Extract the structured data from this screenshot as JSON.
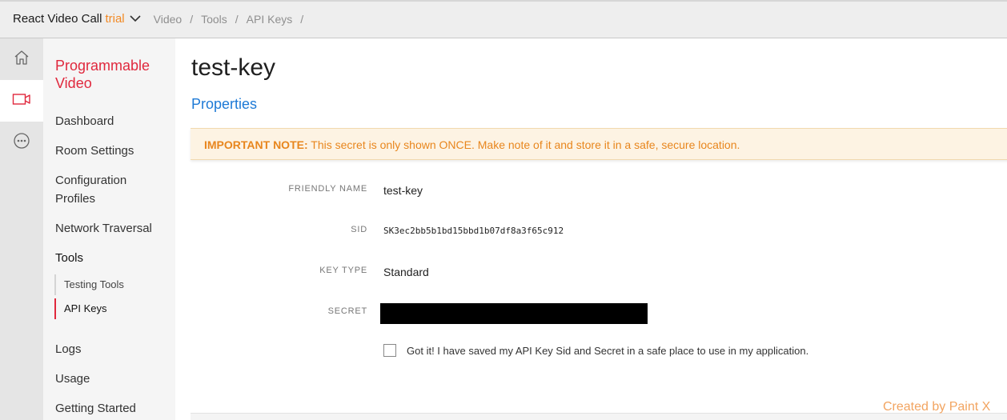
{
  "topbar": {
    "project_name": "React Video Call",
    "project_badge": "trial",
    "breadcrumbs": [
      "Video",
      "Tools",
      "API Keys"
    ],
    "separator": "/"
  },
  "rail": {
    "items": [
      {
        "icon": "home-icon"
      },
      {
        "icon": "video-icon",
        "active": true
      },
      {
        "icon": "more-icon"
      }
    ]
  },
  "sidebar": {
    "title": "Programmable Video",
    "items": {
      "dashboard": "Dashboard",
      "room_settings": "Room Settings",
      "configuration_profiles": "Configuration Profiles",
      "network_traversal": "Network Traversal",
      "tools": "Tools",
      "testing_tools": "Testing Tools",
      "api_keys": "API Keys",
      "logs": "Logs",
      "usage": "Usage",
      "getting_started": "Getting Started"
    }
  },
  "main": {
    "title": "test-key",
    "section": "Properties",
    "note": {
      "label": "IMPORTANT NOTE:",
      "text": " This secret is only shown ONCE. Make note of it and store it in a safe, secure location."
    },
    "fields": {
      "friendly_name": {
        "label": "FRIENDLY NAME",
        "value": "test-key"
      },
      "sid": {
        "label": "SID",
        "value": "SK3ec2bb5b1bd15bbd1b07df8a3f65c912"
      },
      "key_type": {
        "label": "KEY TYPE",
        "value": "Standard"
      },
      "secret": {
        "label": "SECRET"
      }
    },
    "acknowledge": "Got it! I have saved my API Key Sid and Secret in a safe place to use in my application."
  },
  "watermark": "Created by Paint X",
  "colors": {
    "brand_red": "#e0283d",
    "trial_orange": "#f28a25",
    "link_blue": "#1e7ad6",
    "note_bg": "#fdf3e3",
    "note_text": "#e8861d"
  }
}
